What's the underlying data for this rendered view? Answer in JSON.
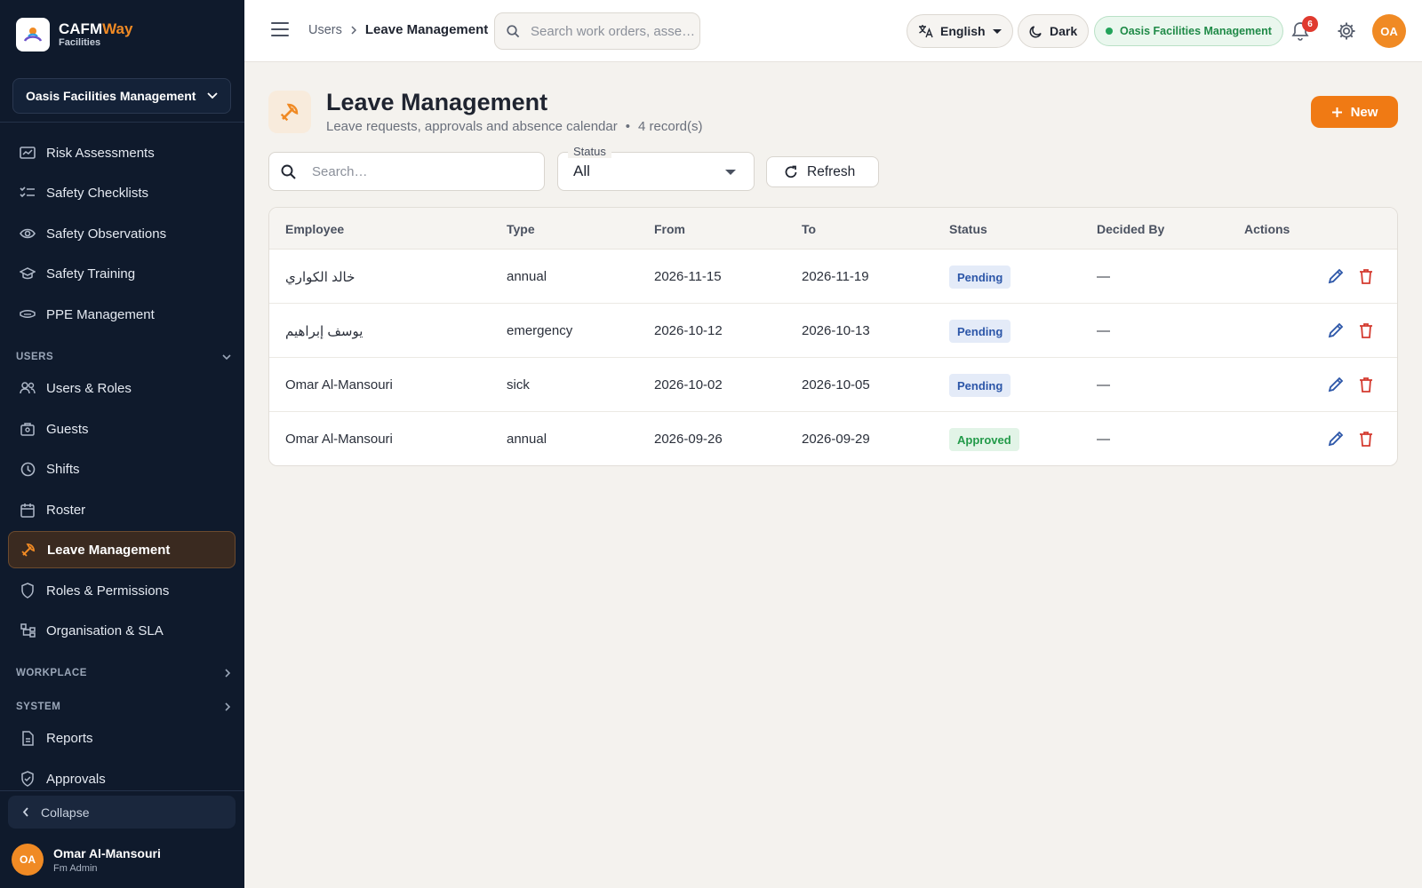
{
  "sidebar": {
    "brand": {
      "name_main": "CAFM",
      "name_accent": "Way",
      "sub": "Facilities"
    },
    "org": "Oasis Facilities Management",
    "items_top": [
      {
        "label": "Risk Assessments",
        "icon": "risk-icon"
      },
      {
        "label": "Safety Checklists",
        "icon": "checklist-icon"
      },
      {
        "label": "Safety Observations",
        "icon": "eye-icon"
      },
      {
        "label": "Safety Training",
        "icon": "training-icon"
      },
      {
        "label": "PPE Management",
        "icon": "ppe-icon"
      }
    ],
    "section_users": "USERS",
    "items_users": [
      {
        "label": "Users & Roles",
        "icon": "users-icon"
      },
      {
        "label": "Guests",
        "icon": "guests-icon"
      },
      {
        "label": "Shifts",
        "icon": "clock-icon"
      },
      {
        "label": "Roster",
        "icon": "calendar-icon"
      },
      {
        "label": "Leave Management",
        "icon": "leave-icon",
        "active": true
      },
      {
        "label": "Roles & Permissions",
        "icon": "shield-icon"
      },
      {
        "label": "Organisation & SLA",
        "icon": "org-icon"
      }
    ],
    "section_workplace": "WORKPLACE",
    "section_system": "SYSTEM",
    "items_system": [
      {
        "label": "Reports",
        "icon": "reports-icon"
      },
      {
        "label": "Approvals",
        "icon": "approvals-icon"
      }
    ],
    "collapse": "Collapse",
    "user": {
      "initials": "OA",
      "name": "Omar Al-Mansouri",
      "role": "Fm Admin"
    }
  },
  "topbar": {
    "breadcrumb": [
      "Users",
      "Leave Management"
    ],
    "search_placeholder": "Search work orders, asse…",
    "language": "English",
    "theme": "Dark",
    "org": "Oasis Facilities Management",
    "notifications": "6",
    "avatar": "OA"
  },
  "page": {
    "title": "Leave Management",
    "subtitle": "Leave requests, approvals and absence calendar",
    "records": "4 record(s)",
    "new_label": "New",
    "search_placeholder": "Search…",
    "status_label": "Status",
    "status_value": "All",
    "refresh_label": "Refresh"
  },
  "table": {
    "columns": [
      "Employee",
      "Type",
      "From",
      "To",
      "Status",
      "Decided By",
      "Actions"
    ],
    "rows": [
      {
        "employee": "خالد الكواري",
        "type": "annual",
        "from": "2026-11-15",
        "to": "2026-11-19",
        "status": "Pending",
        "decided_by": "—"
      },
      {
        "employee": "يوسف إبراهيم",
        "type": "emergency",
        "from": "2026-10-12",
        "to": "2026-10-13",
        "status": "Pending",
        "decided_by": "—"
      },
      {
        "employee": "Omar Al-Mansouri",
        "type": "sick",
        "from": "2026-10-02",
        "to": "2026-10-05",
        "status": "Pending",
        "decided_by": "—"
      },
      {
        "employee": "Omar Al-Mansouri",
        "type": "annual",
        "from": "2026-09-26",
        "to": "2026-09-29",
        "status": "Approved",
        "decided_by": "—"
      }
    ]
  },
  "colors": {
    "accent": "#f07a14",
    "sidebar_bg": "#0f1a2c",
    "pending": "#2c56a8",
    "approved": "#229a49"
  }
}
